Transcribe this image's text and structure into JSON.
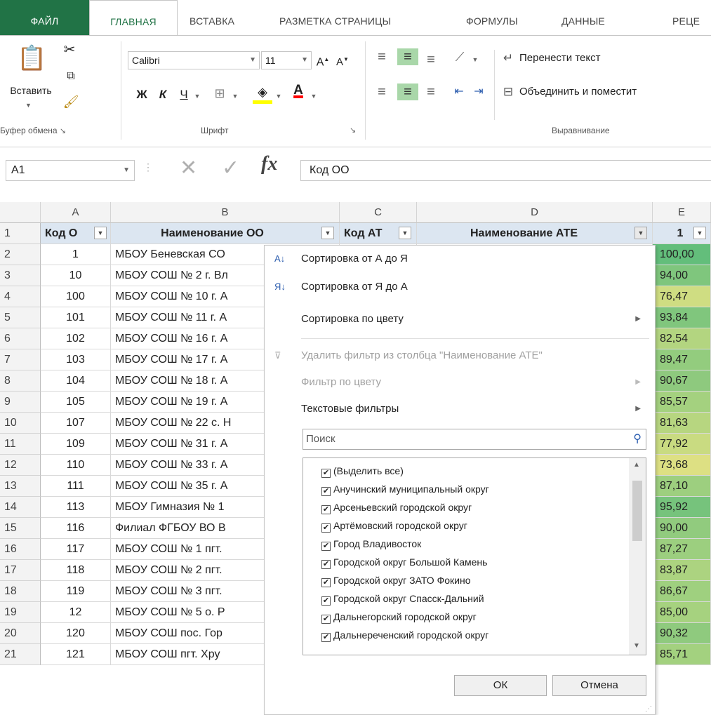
{
  "ribbon": {
    "tabs": [
      "ФАЙЛ",
      "ГЛАВНАЯ",
      "ВСТАВКА",
      "РАЗМЕТКА СТРАНИЦЫ",
      "ФОРМУЛЫ",
      "ДАННЫЕ",
      "РЕЦЕ"
    ],
    "paste_label": "Вставить",
    "font_name": "Calibri",
    "font_size": "11",
    "bold": "Ж",
    "italic": "К",
    "underline": "Ч",
    "wrap_text": "Перенести текст",
    "merge_center": "Объединить и поместит",
    "group_clipboard": "Буфер обмена",
    "group_font": "Шрифт",
    "group_alignment": "Выравнивание",
    "accent_color": "#217346"
  },
  "formula_bar": {
    "name_box": "A1",
    "fx": "fx",
    "content": "Код ОО"
  },
  "grid": {
    "columns": [
      "A",
      "B",
      "C",
      "D",
      "E"
    ],
    "header_row": {
      "row": "1",
      "a": "Код О",
      "b": "Наименование ОО",
      "c": "Код АТ",
      "d": "Наименование АТЕ",
      "e": "1"
    },
    "rows": [
      {
        "n": "2",
        "a": "1",
        "b": "МБОУ Беневская СО",
        "e": "100,00",
        "color": "#63be7b"
      },
      {
        "n": "3",
        "a": "10",
        "b": "МБОУ СОШ № 2 г. Вл",
        "e": "94,00",
        "color": "#7fc67d"
      },
      {
        "n": "4",
        "a": "100",
        "b": "МБОУ СОШ № 10 г. А",
        "e": "76,47",
        "color": "#cfdd82"
      },
      {
        "n": "5",
        "a": "101",
        "b": "МБОУ СОШ № 11 г. А",
        "e": "93,84",
        "color": "#80c67d"
      },
      {
        "n": "6",
        "a": "102",
        "b": "МБОУ СОШ № 16 г. А",
        "e": "82,54",
        "color": "#b3d580"
      },
      {
        "n": "7",
        "a": "103",
        "b": "МБОУ СОШ № 17 г. А",
        "e": "89,47",
        "color": "#93cc7e"
      },
      {
        "n": "8",
        "a": "104",
        "b": "МБОУ СОШ № 18 г. А",
        "e": "90,67",
        "color": "#8ec97e"
      },
      {
        "n": "9",
        "a": "105",
        "b": "МБОУ СОШ № 19 г. А",
        "e": "85,57",
        "color": "#a4d17f"
      },
      {
        "n": "10",
        "a": "107",
        "b": "МБОУ СОШ № 22 с. Н",
        "e": "81,63",
        "color": "#b7d680"
      },
      {
        "n": "11",
        "a": "109",
        "b": "МБОУ СОШ № 31 г. А",
        "e": "77,92",
        "color": "#c9db81"
      },
      {
        "n": "12",
        "a": "110",
        "b": "МБОУ СОШ № 33 г. А",
        "e": "73,68",
        "color": "#dde083"
      },
      {
        "n": "13",
        "a": "111",
        "b": "МБОУ СОШ № 35 г. А",
        "e": "87,10",
        "color": "#9dcf7f"
      },
      {
        "n": "14",
        "a": "113",
        "b": "МБОУ Гимназия № 1",
        "e": "95,92",
        "color": "#76c37c"
      },
      {
        "n": "15",
        "a": "116",
        "b": "Филиал ФГБОУ ВО В",
        "e": "90,00",
        "color": "#91cb7e"
      },
      {
        "n": "16",
        "a": "117",
        "b": "МБОУ СОШ № 1 пгт.",
        "e": "87,27",
        "color": "#9ccf7f"
      },
      {
        "n": "17",
        "a": "118",
        "b": "МБОУ СОШ № 2 пгт.",
        "e": "83,87",
        "color": "#acd380"
      },
      {
        "n": "18",
        "a": "119",
        "b": "МБОУ СОШ № 3 пгт.",
        "e": "86,67",
        "color": "#9fd07f"
      },
      {
        "n": "19",
        "a": "12",
        "b": "МБОУ СОШ № 5 о. Р",
        "e": "85,00",
        "color": "#a6d27f"
      },
      {
        "n": "20",
        "a": "120",
        "b": "МБОУ СОШ пос. Гор",
        "e": "90,32",
        "color": "#8fca7e"
      },
      {
        "n": "21",
        "a": "121",
        "b": "МБОУ СОШ пгт. Хру",
        "e": "85,71",
        "color": "#a3d17f"
      }
    ]
  },
  "dropdown": {
    "sort_az": "Сортировка от А до Я",
    "sort_za": "Сортировка от Я до А",
    "sort_color": "Сортировка по цвету",
    "clear_filter": "Удалить фильтр из столбца \"Наименование АТЕ\"",
    "filter_color": "Фильтр по цвету",
    "text_filters": "Текстовые фильтры",
    "search_placeholder": "Поиск",
    "items": [
      "(Выделить все)",
      "Анучинский муниципальный округ",
      "Арсеньевский городской округ",
      "Артёмовский городской округ",
      "Город Владивосток",
      "Городской округ Большой Камень",
      "Городской округ ЗАТО Фокино",
      "Городской округ Спасск-Дальний",
      "Дальнегорский городской округ",
      "Дальнереченский городской округ"
    ],
    "ok": "ОК",
    "cancel": "Отмена"
  }
}
